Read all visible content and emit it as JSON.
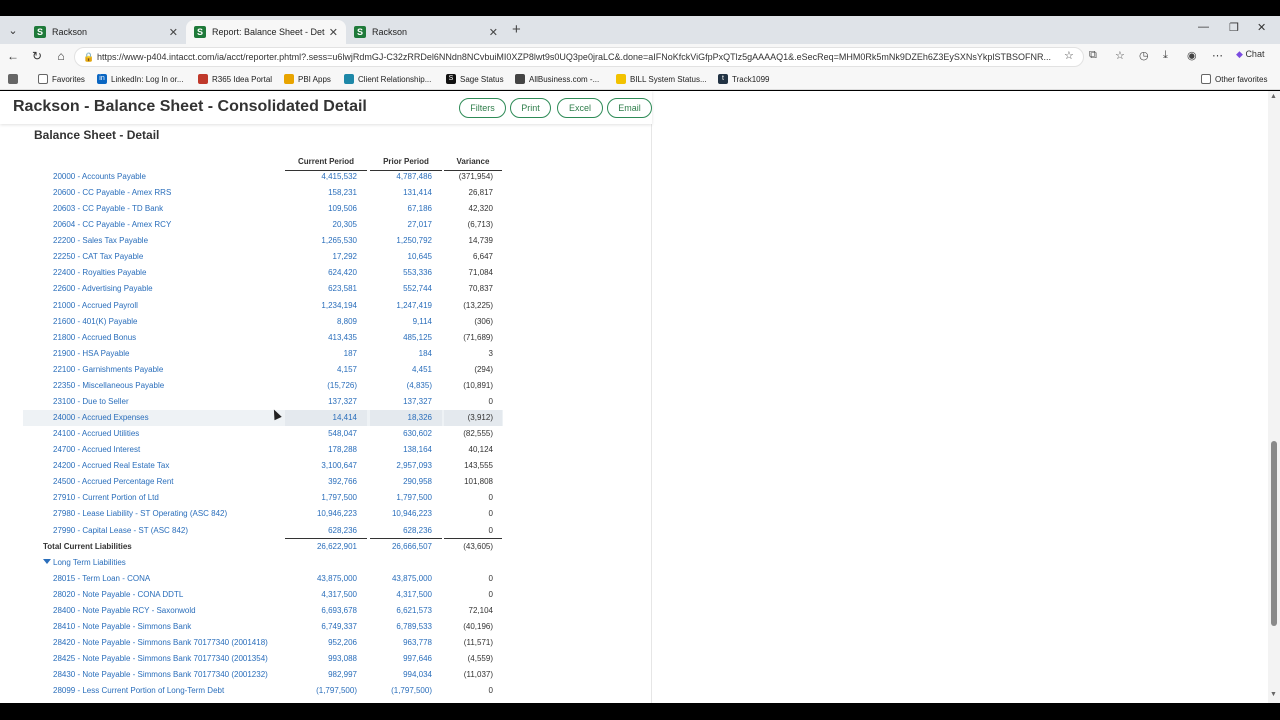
{
  "browser": {
    "tabs": [
      {
        "title": "Rackson",
        "active": false
      },
      {
        "title": "Report: Balance Sheet - Detail",
        "active": true
      },
      {
        "title": "Rackson",
        "active": false
      }
    ],
    "new_tab": "+",
    "url": "https://www-p404.intacct.com/ia/acct/reporter.phtml?.sess=u6lwjRdmGJ-C32zRRDel6NNdn8NCvbuiMI0XZP8lwt9s0UQ3pe0jraLC&.done=aIFNoKfckViGfpPxQTlz5gAAAAQ1&.eSecReq=MHM0Rk5mNk9DZEh6Z3EySXNsYkplSTBSOFNR...",
    "chat_label": "Chat",
    "bookmarks": [
      {
        "label": "",
        "icon": "reading-list-icon"
      },
      {
        "label": "Favorites",
        "icon": "folder-icon"
      },
      {
        "label": "LinkedIn: Log In or...",
        "icon": "linkedin-icon"
      },
      {
        "label": "R365 Idea Portal",
        "icon": "r365-icon"
      },
      {
        "label": "PBI Apps",
        "icon": "pbi-icon"
      },
      {
        "label": "Client Relationship...",
        "icon": "crm-icon"
      },
      {
        "label": "Sage Status",
        "icon": "sage-icon"
      },
      {
        "label": "AllBusiness.com -...",
        "icon": "allbusiness-icon"
      },
      {
        "label": "BILL System Status...",
        "icon": "bill-icon"
      },
      {
        "label": "Track1099",
        "icon": "track1099-icon"
      },
      {
        "label": "Other favorites",
        "icon": "folder-icon"
      }
    ]
  },
  "report": {
    "title": "Rackson - Balance Sheet - Consolidated Detail",
    "buttons": {
      "filters": "Filters",
      "print": "Print",
      "excel": "Excel",
      "email": "Email"
    },
    "subtitle": "Balance Sheet - Detail",
    "columns": {
      "current": "Current Period",
      "prior": "Prior Period",
      "variance": "Variance"
    },
    "rows": [
      {
        "label": "20000 - Accounts Payable",
        "current": "4,415,532",
        "prior": "4,787,486",
        "variance": "(371,954)"
      },
      {
        "label": "20600 - CC Payable - Amex RRS",
        "current": "158,231",
        "prior": "131,414",
        "variance": "26,817"
      },
      {
        "label": "20603 - CC Payable - TD Bank",
        "current": "109,506",
        "prior": "67,186",
        "variance": "42,320"
      },
      {
        "label": "20604 - CC Payable - Amex RCY",
        "current": "20,305",
        "prior": "27,017",
        "variance": "(6,713)"
      },
      {
        "label": "22200 - Sales Tax Payable",
        "current": "1,265,530",
        "prior": "1,250,792",
        "variance": "14,739"
      },
      {
        "label": "22250 - CAT Tax Payable",
        "current": "17,292",
        "prior": "10,645",
        "variance": "6,647"
      },
      {
        "label": "22400 - Royalties Payable",
        "current": "624,420",
        "prior": "553,336",
        "variance": "71,084"
      },
      {
        "label": "22600 - Advertising Payable",
        "current": "623,581",
        "prior": "552,744",
        "variance": "70,837"
      },
      {
        "label": "21000 - Accrued Payroll",
        "current": "1,234,194",
        "prior": "1,247,419",
        "variance": "(13,225)"
      },
      {
        "label": "21600 - 401(K) Payable",
        "current": "8,809",
        "prior": "9,114",
        "variance": "(306)"
      },
      {
        "label": "21800 - Accrued Bonus",
        "current": "413,435",
        "prior": "485,125",
        "variance": "(71,689)"
      },
      {
        "label": "21900 - HSA Payable",
        "current": "187",
        "prior": "184",
        "variance": "3"
      },
      {
        "label": "22100 - Garnishments Payable",
        "current": "4,157",
        "prior": "4,451",
        "variance": "(294)"
      },
      {
        "label": "22350 - Miscellaneous Payable",
        "current": "(15,726)",
        "prior": "(4,835)",
        "variance": "(10,891)"
      },
      {
        "label": "23100 - Due to Seller",
        "current": "137,327",
        "prior": "137,327",
        "variance": "0"
      },
      {
        "label": "24000 - Accrued Expenses",
        "current": "14,414",
        "prior": "18,326",
        "variance": "(3,912)",
        "highlight": true
      },
      {
        "label": "24100 - Accrued Utilities",
        "current": "548,047",
        "prior": "630,602",
        "variance": "(82,555)"
      },
      {
        "label": "24700 - Accrued Interest",
        "current": "178,288",
        "prior": "138,164",
        "variance": "40,124"
      },
      {
        "label": "24200 - Accrued Real Estate Tax",
        "current": "3,100,647",
        "prior": "2,957,093",
        "variance": "143,555"
      },
      {
        "label": "24500 - Accrued Percentage Rent",
        "current": "392,766",
        "prior": "290,958",
        "variance": "101,808"
      },
      {
        "label": "27910 - Current Portion of Ltd",
        "current": "1,797,500",
        "prior": "1,797,500",
        "variance": "0"
      },
      {
        "label": "27980 - Lease Liability - ST Operating (ASC 842)",
        "current": "10,946,223",
        "prior": "10,946,223",
        "variance": "0"
      },
      {
        "label": "27990 - Capital Lease - ST (ASC 842)",
        "current": "628,236",
        "prior": "628,236",
        "variance": "0"
      },
      {
        "label": "Total Current Liabilities",
        "current": "26,622,901",
        "prior": "26,666,507",
        "variance": "(43,605)",
        "kind": "total"
      },
      {
        "label": "Long Term Liabilities",
        "current": "",
        "prior": "",
        "variance": "",
        "kind": "section"
      },
      {
        "label": "28015 - Term Loan - CONA",
        "current": "43,875,000",
        "prior": "43,875,000",
        "variance": "0"
      },
      {
        "label": "28020 - Note Payable - CONA DDTL",
        "current": "4,317,500",
        "prior": "4,317,500",
        "variance": "0"
      },
      {
        "label": "28400 - Note Payable RCY - Saxonwold",
        "current": "6,693,678",
        "prior": "6,621,573",
        "variance": "72,104"
      },
      {
        "label": "28410 - Note Payable - Simmons Bank",
        "current": "6,749,337",
        "prior": "6,789,533",
        "variance": "(40,196)"
      },
      {
        "label": "28420 - Note Payable - Simmons Bank 70177340 (2001418)",
        "current": "952,206",
        "prior": "963,778",
        "variance": "(11,571)"
      },
      {
        "label": "28425 - Note Payable - Simmons Bank 70177340 (2001354)",
        "current": "993,088",
        "prior": "997,646",
        "variance": "(4,559)"
      },
      {
        "label": "28430 - Note Payable - Simmons Bank 70177340 (2001232)",
        "current": "982,997",
        "prior": "994,034",
        "variance": "(11,037)"
      },
      {
        "label": "28099 - Less Current Portion of Long-Term Debt",
        "current": "(1,797,500)",
        "prior": "(1,797,500)",
        "variance": "0"
      }
    ]
  }
}
